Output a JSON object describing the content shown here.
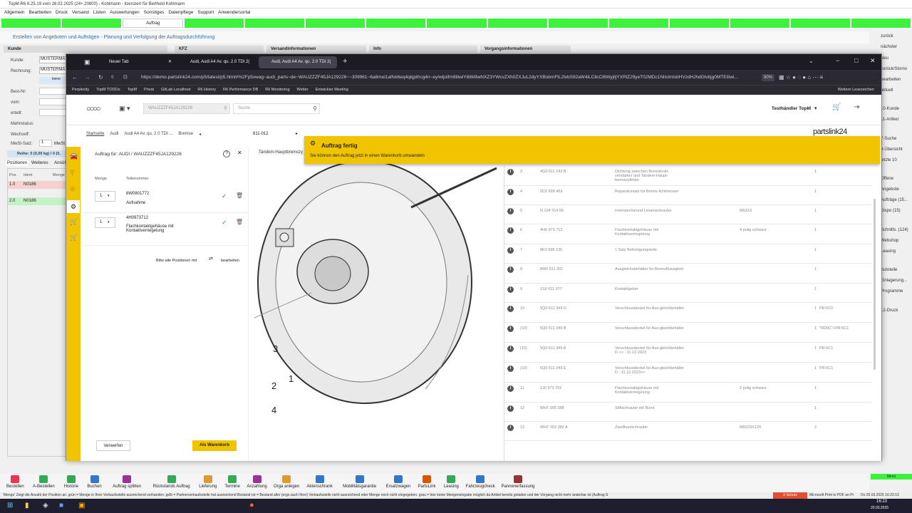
{
  "app": {
    "title": "TopM-R6 6.25.19 vom 28.02.2025 (24+.20800) - Kohlmann - lizenziert für Berthold Kohlmann",
    "menu": [
      "Allgemein",
      "Bearbeiten",
      "Druck",
      "Versand",
      "Listen",
      "Auswertungen",
      "Sonstiges",
      "Datenpflege",
      "Support",
      "Anwendersortal"
    ],
    "active_tab": "Auftrag",
    "subheader": "Erstellen von Angeboten und Aufträgen - Planung und Verfolgung der Auftragsdurchführung",
    "sections": {
      "kunde": "Kunde",
      "kfz": "KFZ",
      "versand": "Versandinformationen",
      "info": "Info",
      "vorgang": "Vorgangsinformationen"
    },
    "left": {
      "kunde_label": "Kunde:",
      "kunde_value": "MUSTERMA",
      "rechnung_label": "Rechnung:",
      "rechnung_value": "MUSTERMA",
      "keine": "keine",
      "best_nr": "Best-Nr:",
      "vom": "vom:",
      "erteilt": "erteilt:",
      "mahnstatus": "Mahnstatus:",
      "wechself": "Wechself:",
      "mwst_satz": "MwSt-Satz:",
      "mwst_value": "1",
      "mwst_label": "MwSt",
      "reihe": "Reihe: 0 (0,00 kg) / 0 (0,",
      "tabs": [
        "Positionen",
        "Weiteres",
        "Ansicht"
      ],
      "cols": [
        "Pos",
        "Ident",
        "Menge"
      ],
      "rows": [
        {
          "pos": "1.0",
          "ident": "N0186"
        },
        {
          "pos": "2.0",
          "ident": "N0186"
        }
      ]
    },
    "right": [
      "zurück",
      "nächster",
      "Neu",
      "zurück/Storno",
      "bearbeiten",
      "aktuell",
      "10-Kunde",
      "11-Artikel",
      "7-Suche",
      "9-Übersicht",
      "letzte 10",
      "Offene",
      "Angebote",
      "Aufträge (15...",
      "Dispo (15)",
      "Schnitts. (124)",
      "Webshop",
      "Leasing",
      "Autoteile",
      "Einlagerung...",
      "Programme",
      "12-Druck"
    ],
    "bottom_tools": [
      "Bestellen",
      "A-Bestellen",
      "Historie",
      "Buchen",
      "Auftrag splitten",
      "Rückstands Auftrag",
      "Lieferung",
      "Termine",
      "Anzahlung",
      "Orga anlegen",
      "Aktenschrank",
      "Mobilitätsgarantie",
      "Ersatzwagen",
      "PartsLink",
      "Leasing",
      "Fahrzeugcheck",
      "Pannenerfassung"
    ],
    "bottom_right": "Menü",
    "status": "'Menge' Zeigt die Anzahl der Position an. grün = Menge in Ihrer Verkaufsstelle ausreichend vorhanden. gelb = Partnerverkaufsstelle hat ausreichend Bestand rot = Bestand aller (ergo auch Ihrer) Verkaufsstelle nicht ausreichend oder Menge noch nicht eingegeben. grau = hier keine Mengeneingabe möglich da Artikel bereits geladen und der Vorgang nicht mehr änderbar ist (Auftrag S",
    "status_right1": "2-Schutz",
    "status_right2": "Microsoft Print to PDF an Pr",
    "status_date": "Do 20.03.2025 16:23:13",
    "clock": "16:23",
    "clock_date": "20.03.2025"
  },
  "browser": {
    "tabs": [
      "Neuer Tab",
      "Audi, Audi A4 Av. qu. 2.0 TDI 2(",
      "Audi, Audi A4 Av. qu. 2.0 TDI 2("
    ],
    "url": "https://demo.partslink24.com/p5/latest/p5.html#%2Fp5vwag~audi_parts~de~WAUZZZF45JA129226~~309961~6a6mei1alfvk6eq4qkjpthcg4n~ey/wljoifm9tliwiYi86li9wNXZ3YWcvZXh0ZXJuL2dyYXBobmFtL2lvbS92aW4iLCllcCl6WyjlljYXRlZ29yeT02MDc1NilsImlsbHVzdHJhdGlvbjg0MTEiIiwi...",
    "zoom": "90%",
    "bookmarks": [
      "Perplexity",
      "TopM TODOs",
      "TopM",
      "Privat",
      "GitLab Localhost",
      "R6 History",
      "R6 Performance DB",
      "R6 Monitoring",
      "Wetter",
      "Entwickler Meeting"
    ],
    "more_bookmarks": "Weitere Lesezeichen"
  },
  "site": {
    "vin": "WAUZZZF45JA129226",
    "search_placeholder": "Suche",
    "dealer": "Testhändler TopM",
    "brand": "partslink24",
    "breadcrumb": [
      "Startseite",
      "Audi",
      "Audi A4 Av. qu. 2.0 TDI ...",
      "Bremse"
    ],
    "breadcrumb_code": "611-012",
    "order_title": "Auftrag für: AUDI / WAUZZZF45JA129226",
    "col_menge": "Menge",
    "col_teil": "Teilenummer",
    "order_items": [
      {
        "qty": "1",
        "number": "8W0801772",
        "desc": "Aufnahme"
      },
      {
        "qty": "1",
        "number": "4H0973712",
        "desc": "Flachkontaktgehäuse mit Kontaktverriegelung"
      }
    ],
    "edit_hint_1": "Bitte alle Positionen mit",
    "edit_hint_2": "bearbeiten",
    "btn_discard": "Verwerfen",
    "btn_cart": "Als Warenkorb",
    "illustration_label": "Tandem-Hauptbremszy",
    "illustration_numbers": [
      "3",
      "2",
      "1",
      "4"
    ],
    "toast_title": "Auftrag fertig",
    "toast_text": "Sie können den Auftrag jetzt in einen Warenkorb umwandeln",
    "parts": [
      {
        "pos": "3",
        "num": "4G0 611 243 B",
        "desc": "Dichtung zwischen Bremskraft-verstärker und Tandem-Haupt-bremszylinder",
        "info": "",
        "qty": "1",
        "note": ""
      },
      {
        "pos": "4",
        "num": "5C6 698 459",
        "desc": "Reparatursatz für Brems-lichtmesser",
        "info": "",
        "qty": "1",
        "note": ""
      },
      {
        "pos": "5",
        "num": "N  104 514 05",
        "desc": "Innensechsrund Linsenschraube",
        "info": "M6X16",
        "qty": "1",
        "note": ""
      },
      {
        "pos": "6",
        "num": "4H0 973 712",
        "desc": "Flachkontaktgehäuse mit Kontaktverriegelung",
        "info": "4 polig schwarz",
        "qty": "1",
        "note": ""
      },
      {
        "pos": "7",
        "num": "8K0 698 135",
        "desc": "1 Satz Befestigungsteile",
        "info": "",
        "qty": "1",
        "note": ""
      },
      {
        "pos": "8",
        "num": "8W0 611 301",
        "desc": "Ausgleichsbehälter für Bremsflüssigkeit",
        "info": "",
        "qty": "1",
        "note": ""
      },
      {
        "pos": "9",
        "num": "1S0 611 377",
        "desc": "Kontaktgeber",
        "info": "",
        "qty": "1",
        "note": ""
      },
      {
        "pos": "10",
        "num": "5Q0 611 349 D",
        "desc": "Verschlussdeckel für Aus-gleichbehälter",
        "info": "",
        "qty": "1",
        "note": "PR:5C0"
      },
      {
        "pos": "(10)",
        "num": "5Q0 611 349 B",
        "desc": "Verschlussdeckel für Aus-gleichbehälter",
        "info": "",
        "qty": "1",
        "note": "\"RD0C\"+PR:5C1"
      },
      {
        "pos": "(10)",
        "num": "5Q0 611 349 A",
        "desc": "Verschlussdeckel für Aus-gleichbehälter D          >> - 11.12.2023",
        "info": "",
        "qty": "1",
        "note": "PR:5C1"
      },
      {
        "pos": "(10)",
        "num": "5Q0 611 349 E",
        "desc": "Verschlussdeckel für Aus-gleichbehälter D - 11.12.2023>>",
        "info": "",
        "qty": "1",
        "note": "PR:5C1"
      },
      {
        "pos": "11",
        "num": "1J0 973 702",
        "desc": "Flachkontaktgehäuse mit Kontaktverriegelung",
        "info": "2 polig schwarz",
        "qty": "1",
        "note": ""
      },
      {
        "pos": "12",
        "num": "WHT 005 388",
        "desc": "Stiftschraube mit Bund",
        "info": "",
        "qty": "1",
        "note": ""
      },
      {
        "pos": "13",
        "num": "WHT 003 382 A",
        "desc": "Zweifkantschraube",
        "info": "M8X25X125",
        "qty": "2",
        "note": ""
      }
    ]
  },
  "colors": {
    "green": "#3cf23c",
    "yellow": "#f0c400",
    "dark": "#1c1b22",
    "audi_blue": "#1c1b5c"
  }
}
